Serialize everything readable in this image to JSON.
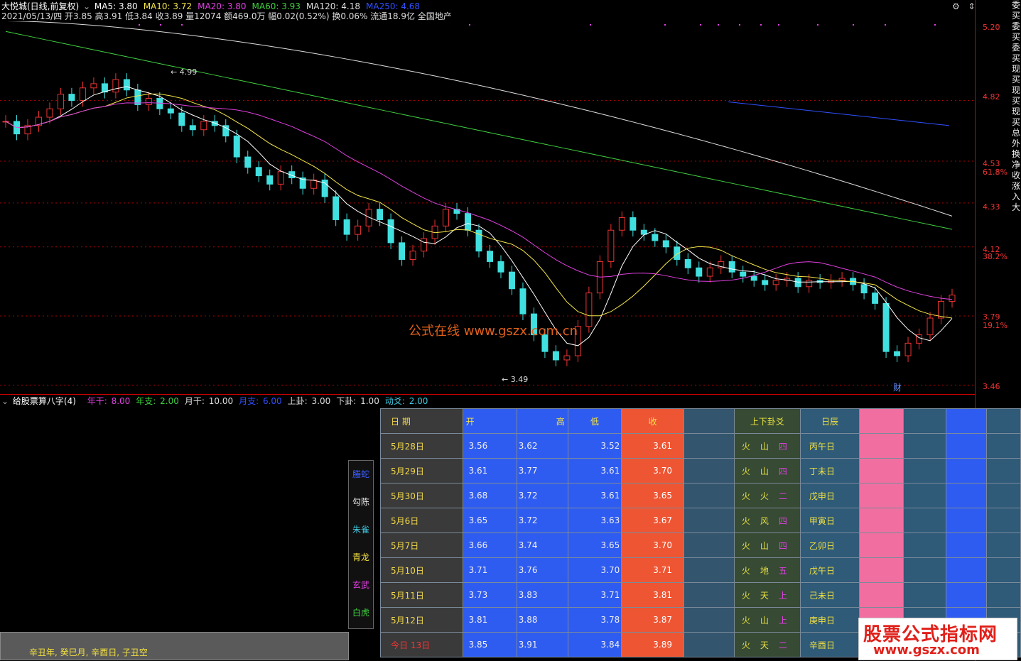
{
  "header": {
    "stock": "大悦城(日线,前复权)",
    "ma": [
      {
        "label": "MA5: 3.80",
        "color": "#ffffff"
      },
      {
        "label": "MA10: 3.72",
        "color": "#f5e64a"
      },
      {
        "label": "MA20: 3.80",
        "color": "#e040e0"
      },
      {
        "label": "MA60: 3.93",
        "color": "#40d040"
      },
      {
        "label": "MA120: 4.18",
        "color": "#dddddd"
      },
      {
        "label": "MA250: 4.68",
        "color": "#3050ff"
      }
    ],
    "quote_line": "2021/05/13/四 开3.85 高3.91 低3.84 收3.89 量12074 额469.0万 幅0.02(0.52%) 换0.06% 流通18.9亿 全国地产"
  },
  "price_axis": {
    "labels": [
      "5.20",
      "4.82",
      "4.53",
      "61.8%",
      "4.33",
      "4.12",
      "38.2%",
      "3.79",
      "19.1%",
      "3.46"
    ],
    "colors": {
      "axis": "#ee3333"
    }
  },
  "annotations": {
    "high": "4.99",
    "low": "3.49",
    "watermark": "公式在线  www.gszx.com.cn",
    "cai": "财"
  },
  "indicator": {
    "title": "给股票算八字(4)",
    "params": [
      {
        "label": "年干: ",
        "value": "8.00",
        "color": "#e040e0"
      },
      {
        "label": "年支: ",
        "value": "2.00",
        "color": "#40d040"
      },
      {
        "label": "月干: ",
        "value": "10.00",
        "color": "#dddddd"
      },
      {
        "label": "月支: ",
        "value": "6.00",
        "color": "#3050ff"
      },
      {
        "label": "上卦: ",
        "value": "3.00",
        "color": "#dddddd"
      },
      {
        "label": "下卦: ",
        "value": "1.00",
        "color": "#dddddd"
      },
      {
        "label": "动爻: ",
        "value": "2.00",
        "color": "#40c8e0"
      }
    ]
  },
  "table": {
    "headers": {
      "date": "日  期",
      "open": "开",
      "high": "高",
      "low": "低",
      "close": "收",
      "gua": "上下卦爻",
      "ri": "日辰"
    },
    "rows": [
      {
        "date": "5月28日",
        "open": "3.56",
        "high": "3.62",
        "low": "3.52",
        "close": "3.61",
        "gua": [
          "火",
          "山",
          "四"
        ],
        "ri": "丙午日"
      },
      {
        "date": "5月29日",
        "open": "3.61",
        "high": "3.77",
        "low": "3.61",
        "close": "3.70",
        "gua": [
          "火",
          "山",
          "四"
        ],
        "ri": "丁未日"
      },
      {
        "date": "5月30日",
        "open": "3.68",
        "high": "3.72",
        "low": "3.61",
        "close": "3.65",
        "gua": [
          "火",
          "火",
          "二"
        ],
        "ri": "戊申日"
      },
      {
        "date": "5月6日",
        "open": "3.65",
        "high": "3.72",
        "low": "3.63",
        "close": "3.67",
        "gua": [
          "火",
          "风",
          "四"
        ],
        "ri": "甲寅日"
      },
      {
        "date": "5月7日",
        "open": "3.66",
        "high": "3.74",
        "low": "3.65",
        "close": "3.70",
        "gua": [
          "火",
          "山",
          "四"
        ],
        "ri": "乙卯日"
      },
      {
        "date": "5月10日",
        "open": "3.71",
        "high": "3.76",
        "low": "3.70",
        "close": "3.71",
        "gua": [
          "火",
          "地",
          "五"
        ],
        "ri": "戊午日"
      },
      {
        "date": "5月11日",
        "open": "3.73",
        "high": "3.83",
        "low": "3.71",
        "close": "3.81",
        "gua": [
          "火",
          "天",
          "上"
        ],
        "ri": "己未日"
      },
      {
        "date": "5月12日",
        "open": "3.81",
        "high": "3.88",
        "low": "3.78",
        "close": "3.87",
        "gua": [
          "火",
          "山",
          "上"
        ],
        "ri": "庚申日"
      },
      {
        "date": "今日  13日",
        "open": "3.85",
        "high": "3.91",
        "low": "3.84",
        "close": "3.89",
        "gua": [
          "火",
          "天",
          "二"
        ],
        "ri": "辛酉日"
      }
    ]
  },
  "shen": [
    {
      "name": "螣蛇",
      "color": "#3a5cff"
    },
    {
      "name": "勾陈",
      "color": "#eeeeee"
    },
    {
      "name": "朱雀",
      "color": "#40c8e0"
    },
    {
      "name": "青龙",
      "color": "#f2e040"
    },
    {
      "name": "玄武",
      "color": "#e040e0"
    },
    {
      "name": "白虎",
      "color": "#40d040"
    }
  ],
  "ganzhi": "辛丑年, 癸巳月, 辛酉日, 子丑空",
  "right_vertical": "委买委买委买现买现买现买总外换净收涨入大",
  "brand": {
    "title": "股票公式指标网",
    "url": "www.gszx.com"
  }
}
